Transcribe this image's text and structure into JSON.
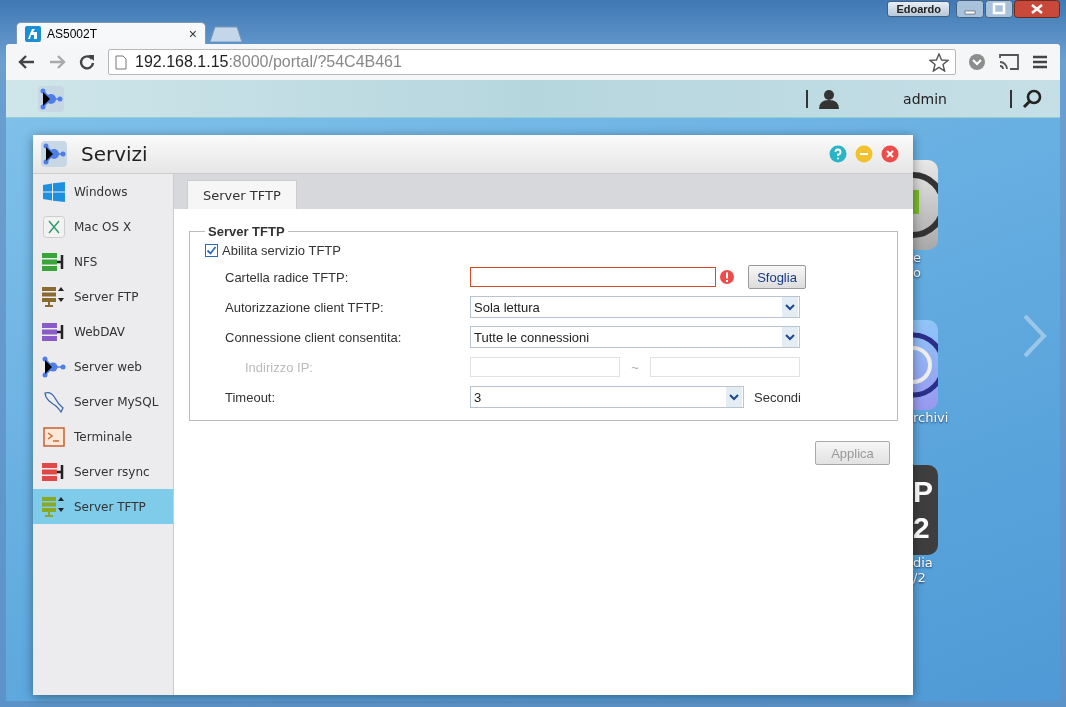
{
  "browser": {
    "profile": "Edoardo",
    "tabs": [
      {
        "title": "AS5002T",
        "close": "×",
        "selected": true
      }
    ],
    "url_host": "192.168.1.15",
    "url_rest": ":8000/portal/?54C4B461"
  },
  "topbar": {
    "user": "admin"
  },
  "window": {
    "title": "Servizi",
    "sidebar": [
      {
        "label": "Windows",
        "kind": "windows",
        "selected": false
      },
      {
        "label": "Mac OS X",
        "kind": "mac",
        "selected": false
      },
      {
        "label": "NFS",
        "kind": "share",
        "color": "#3aa43a",
        "selected": false
      },
      {
        "label": "Server FTP",
        "kind": "transfer",
        "color": "#8a6a30",
        "selected": false
      },
      {
        "label": "WebDAV",
        "kind": "share",
        "color": "#8a5cc8",
        "selected": false
      },
      {
        "label": "Server web",
        "kind": "web",
        "selected": false
      },
      {
        "label": "Server MySQL",
        "kind": "mysql",
        "selected": false
      },
      {
        "label": "Terminale",
        "kind": "terminal",
        "selected": false
      },
      {
        "label": "Server rsync",
        "kind": "share",
        "color": "#e04848",
        "selected": false
      },
      {
        "label": "Server TFTP",
        "kind": "transfer",
        "color": "#8aa820",
        "selected": true
      }
    ],
    "tabs": [
      {
        "label": "Server TFTP",
        "selected": true
      }
    ],
    "group": {
      "legend": "Server TFTP",
      "enable": {
        "label": "Abilita servizio TFTP",
        "checked": true
      },
      "rows": [
        {
          "kind": "path",
          "label": "Cartella radice TFTP:",
          "error": true,
          "button": "Sfoglia"
        },
        {
          "kind": "select",
          "label": "Autorizzazione client TFTP:",
          "value": "Sola lettura"
        },
        {
          "kind": "select",
          "label": "Connessione client consentita:",
          "value": "Tutte le connessioni"
        },
        {
          "kind": "range",
          "label": "Indirizzo IP:",
          "separator": "~",
          "disabled": true
        },
        {
          "kind": "select_unit",
          "label": "Timeout:",
          "value": "3",
          "unit": "Secondi"
        }
      ]
    },
    "apply": {
      "label": "Applica",
      "disabled": true
    }
  },
  "desktop": {
    "icons": [
      {
        "kind": "power",
        "lines": [
          "e",
          "o"
        ]
      },
      {
        "kind": "disc",
        "lines": [
          "rchivi"
        ]
      },
      {
        "kind": "media",
        "glyphs": [
          "P",
          "2"
        ],
        "lines": [
          "dia",
          "/2"
        ]
      }
    ]
  }
}
